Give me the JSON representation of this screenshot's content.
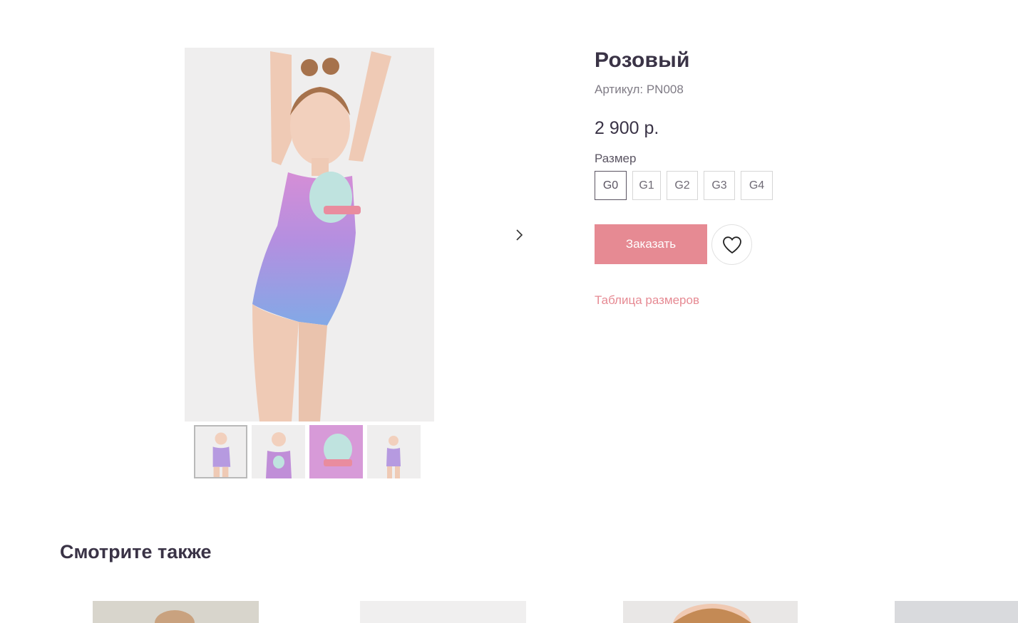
{
  "product": {
    "title": "Розовый",
    "sku": "Артикул: PN008",
    "price": "2 900 р.",
    "size_label": "Размер",
    "sizes": [
      "G0",
      "G1",
      "G2",
      "G3",
      "G4"
    ],
    "selected_size": "G0",
    "order_label": "Заказать",
    "size_table_label": "Таблица размеров"
  },
  "gallery": {
    "thumbnail_count": 4,
    "active_thumbnail": 1
  },
  "related": {
    "title": "Смотрите также",
    "item_count": 4
  },
  "colors": {
    "accent": "#e68a93",
    "text": "#3a3346",
    "muted": "#7f7b85"
  },
  "icons": {
    "next": "chevron-right-icon",
    "favorite": "heart-icon"
  }
}
